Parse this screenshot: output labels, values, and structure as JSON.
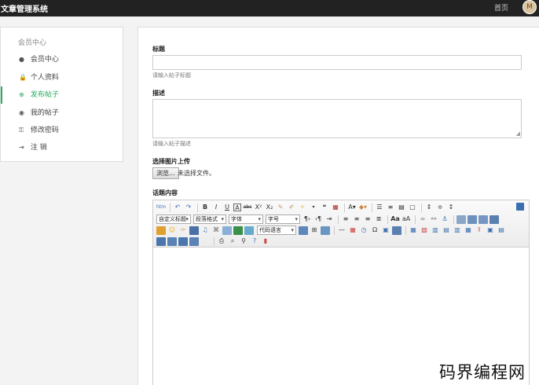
{
  "topbar": {
    "brand": "文章管理系统",
    "home": "首页",
    "avatar_letter": "M"
  },
  "sidebar": {
    "heading": "会员中心",
    "items": [
      {
        "label": "会员中心",
        "icon": "user-circle-icon",
        "glyph": "●"
      },
      {
        "label": "个人资料",
        "icon": "lock-icon",
        "glyph": "🔒"
      },
      {
        "label": "发布帖子",
        "icon": "plus-circle-icon",
        "glyph": "⊕"
      },
      {
        "label": "我的帖子",
        "icon": "document-icon",
        "glyph": "◉"
      },
      {
        "label": "修改密码",
        "icon": "key-icon",
        "glyph": "⚿"
      },
      {
        "label": "注 销",
        "icon": "logout-icon",
        "glyph": "⇥"
      }
    ],
    "active_index": 2,
    "accent_color": "#27ae60"
  },
  "form": {
    "title_label": "标题",
    "title_help": "请输入帖子标题",
    "title_value": "",
    "desc_label": "描述",
    "desc_help": "请输入帖子描述",
    "desc_value": "",
    "image_label": "选择图片上传",
    "file_button": "浏览...",
    "file_status": "未选择文件。",
    "content_label": "话题内容"
  },
  "editor": {
    "selects": {
      "title_style": "自定义标题",
      "paragraph": "段落格式",
      "font_family": "字体",
      "font_size": "字号",
      "code_lang": "代码语言"
    }
  },
  "watermark": "码界编程网"
}
